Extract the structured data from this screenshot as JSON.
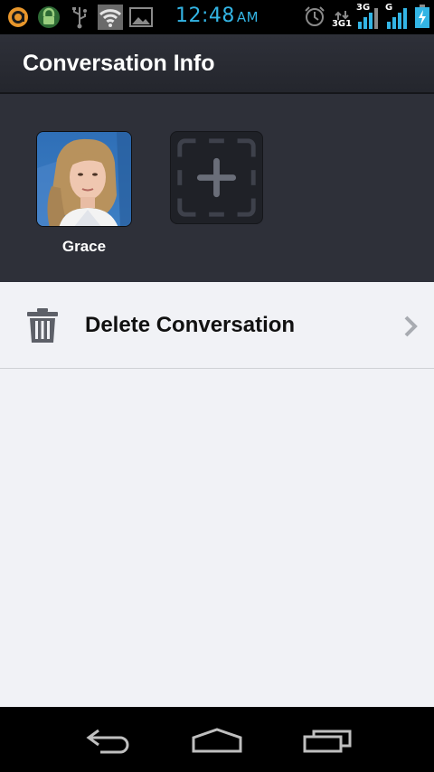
{
  "status_bar": {
    "time": "12:48",
    "ampm": "AM",
    "network_3g": "3G",
    "network_3g_sub": "3G1",
    "network_g": "G",
    "icons": [
      "app-icon",
      "lock-icon",
      "usb-icon",
      "wifi-icon",
      "image-icon",
      "alarm-icon",
      "data-transfer-icon",
      "signal-icon",
      "battery-charging-icon"
    ],
    "accent_color": "#33b5e5"
  },
  "action_bar": {
    "title": "Conversation Info"
  },
  "participants": {
    "members": [
      {
        "name": "Grace"
      }
    ],
    "add_icon": "plus-icon"
  },
  "actions": [
    {
      "label": "Delete Conversation",
      "icon": "trash-icon",
      "trailing_icon": "chevron-right-icon"
    }
  ],
  "nav_bar": {
    "buttons": [
      "back-icon",
      "home-icon",
      "recent-apps-icon"
    ]
  }
}
